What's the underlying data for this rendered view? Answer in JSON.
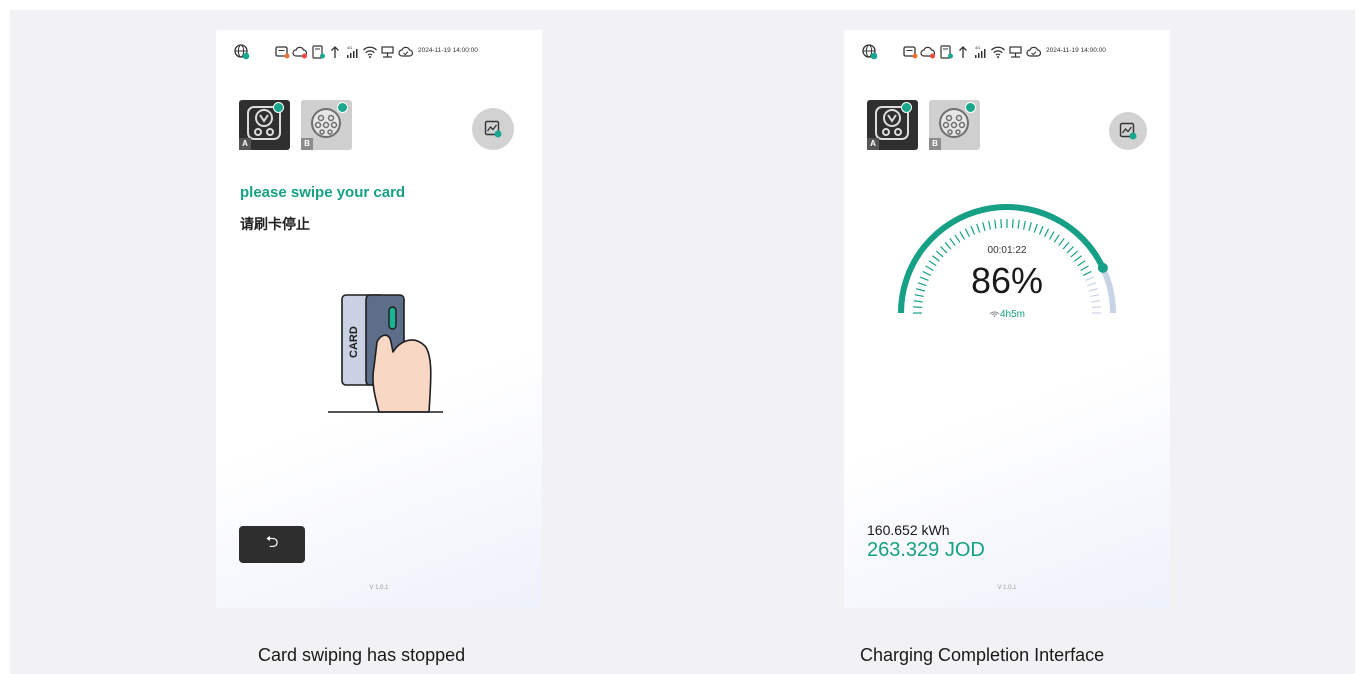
{
  "left_panel": {
    "status_time": "2024-11-19 14:00:00",
    "connectors": [
      {
        "label": "A",
        "state": "active"
      },
      {
        "label": "B",
        "state": "idle"
      }
    ],
    "prompt_title": "please swipe your card",
    "prompt_subtitle": "请刷卡停止",
    "card_text": "CARD",
    "back_icon": "return-arrow-icon",
    "back_glyph": "⮌",
    "version": "V 1.0.1"
  },
  "right_panel": {
    "status_time": "2024-11-19 14:00:00",
    "connectors": [
      {
        "label": "A",
        "state": "active"
      },
      {
        "label": "B",
        "state": "idle"
      }
    ],
    "gauge": {
      "elapsed": "00:01:22",
      "percent_text": "86%",
      "percent": 86,
      "remaining": "4h5m"
    },
    "energy": "160.652 kWh",
    "cost": "263.329 JOD",
    "version": "V 1.0.1"
  },
  "captions": {
    "left": "Card swiping has stopped",
    "right": "Charging Completion Interface"
  },
  "colors": {
    "accent": "#16a085",
    "gauge_track": "#c9d3e6",
    "dark_button": "#2e2e2e"
  }
}
